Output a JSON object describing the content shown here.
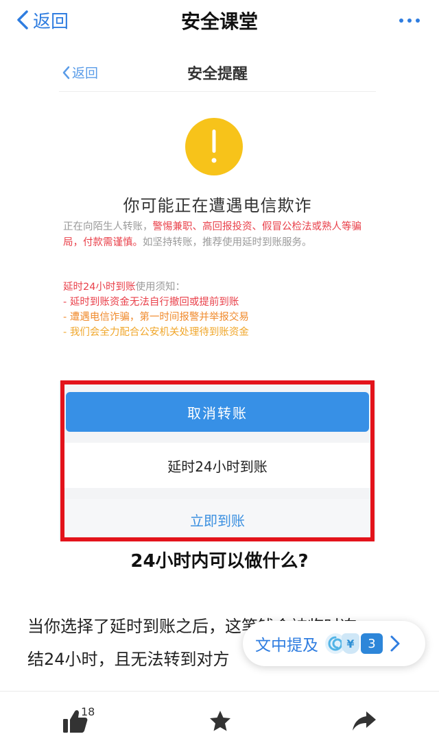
{
  "nav": {
    "back_label": "返回",
    "title": "安全课堂"
  },
  "screenshot": {
    "nav": {
      "back_label": "返回",
      "title": "安全提醒"
    },
    "headline": "你可能正在遭遇电信欺诈",
    "paragraph": {
      "part1": "正在向陌生人转账，",
      "part2_red": "警惕兼职、高回报投资、假冒公检法或熟人等骗局，付款需谨慎。",
      "part3": "如坚持转账，推荐使用延时到账服务。"
    },
    "notice": {
      "head_red": "延时24小时到账",
      "head_rest": "使用须知：",
      "line1": "- 延时到账资金无法自行撤回或提前到账",
      "line2": "- 遭遇电信诈骗，第一时间报警并举报交易",
      "line3": "- 我们会全力配合公安机关处理待到账资金"
    },
    "buttons": {
      "cancel": "取消转账",
      "delay": "延时24小时到账",
      "now": "立即到账"
    }
  },
  "subheading": "24小时内可以做什么?",
  "body": {
    "line1": "当你选择了延时到账之后，这笔钱会被临时冻",
    "line2": "结24小时，且无法转到对方"
  },
  "mention": {
    "label": "文中提及",
    "count": "3",
    "icon_badge": "¥"
  },
  "bottom_bar": {
    "like_count": "18"
  },
  "colors": {
    "accent": "#2f7de0",
    "warning": "#f7c31a",
    "highlight_box": "#e3131b",
    "primary_button": "#3790e6"
  }
}
